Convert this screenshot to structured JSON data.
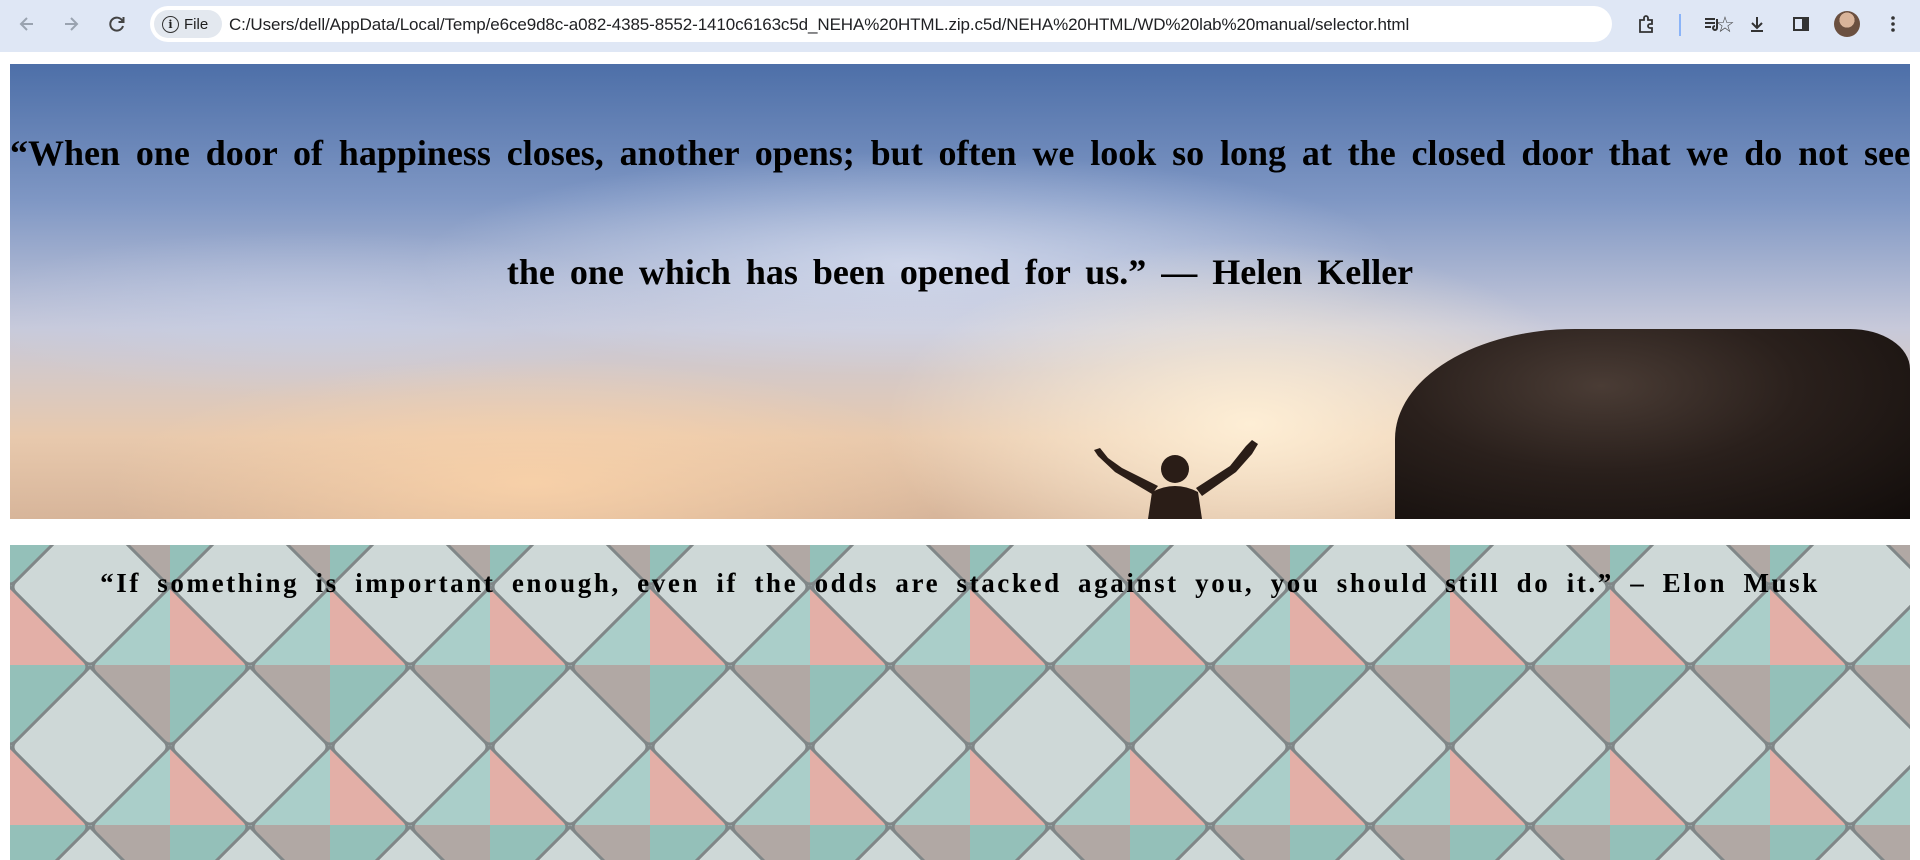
{
  "browser": {
    "site_chip_label": "File",
    "url": "C:/Users/dell/AppData/Local/Temp/e6ce9d8c-a082-4385-8552-1410c6163c5d_NEHA%20HTML.zip.c5d/NEHA%20HTML/WD%20lab%20manual/selector.html",
    "icons": [
      "back-icon",
      "forward-icon",
      "reload-icon",
      "info-icon",
      "star-icon",
      "extensions-icon",
      "media-controls-icon",
      "download-icon",
      "side-panel-icon",
      "avatar",
      "menu-icon"
    ]
  },
  "page": {
    "quote_1": "“When one door of happiness closes, another opens; but often we look so long at the closed door that we do not see the one which has been opened for us.” — Helen Keller",
    "quote_2": "“If something is important enough, even if the odds are stacked against you, you should still do it.” – Elon Musk"
  },
  "colors": {
    "toolbar_bg": "#dfe7f5",
    "omnibox_bg": "#ffffff",
    "quote_text": "#000000"
  }
}
